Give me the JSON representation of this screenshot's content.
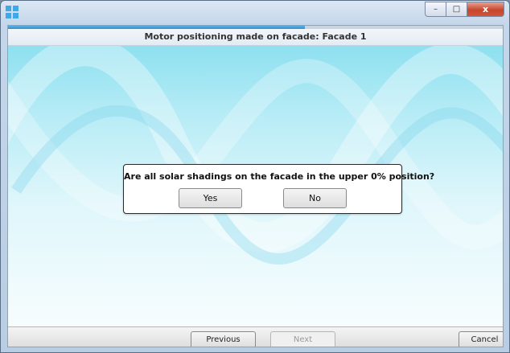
{
  "window": {
    "app_icon": "windows-tiles-icon",
    "controls": {
      "minimize_icon": "minimize-icon",
      "maximize_icon": "maximize-icon",
      "close_icon": "close-icon"
    },
    "minimize_glyph": "–",
    "maximize_glyph": "□",
    "close_glyph": "x"
  },
  "wizard": {
    "progress_fraction": 0.6,
    "header_title": "Motor positioning made on facade: Facade 1"
  },
  "dialog": {
    "question": "Are all solar shadings on the facade in the upper 0% position?",
    "yes_label": "Yes",
    "no_label": "No"
  },
  "footer": {
    "previous_label": "Previous",
    "next_label": "Next",
    "next_enabled": false,
    "cancel_label": "Cancel"
  },
  "colors": {
    "accent": "#2f8fcf",
    "close_button": "#c7472d",
    "background_top": "#8ee0f0"
  }
}
